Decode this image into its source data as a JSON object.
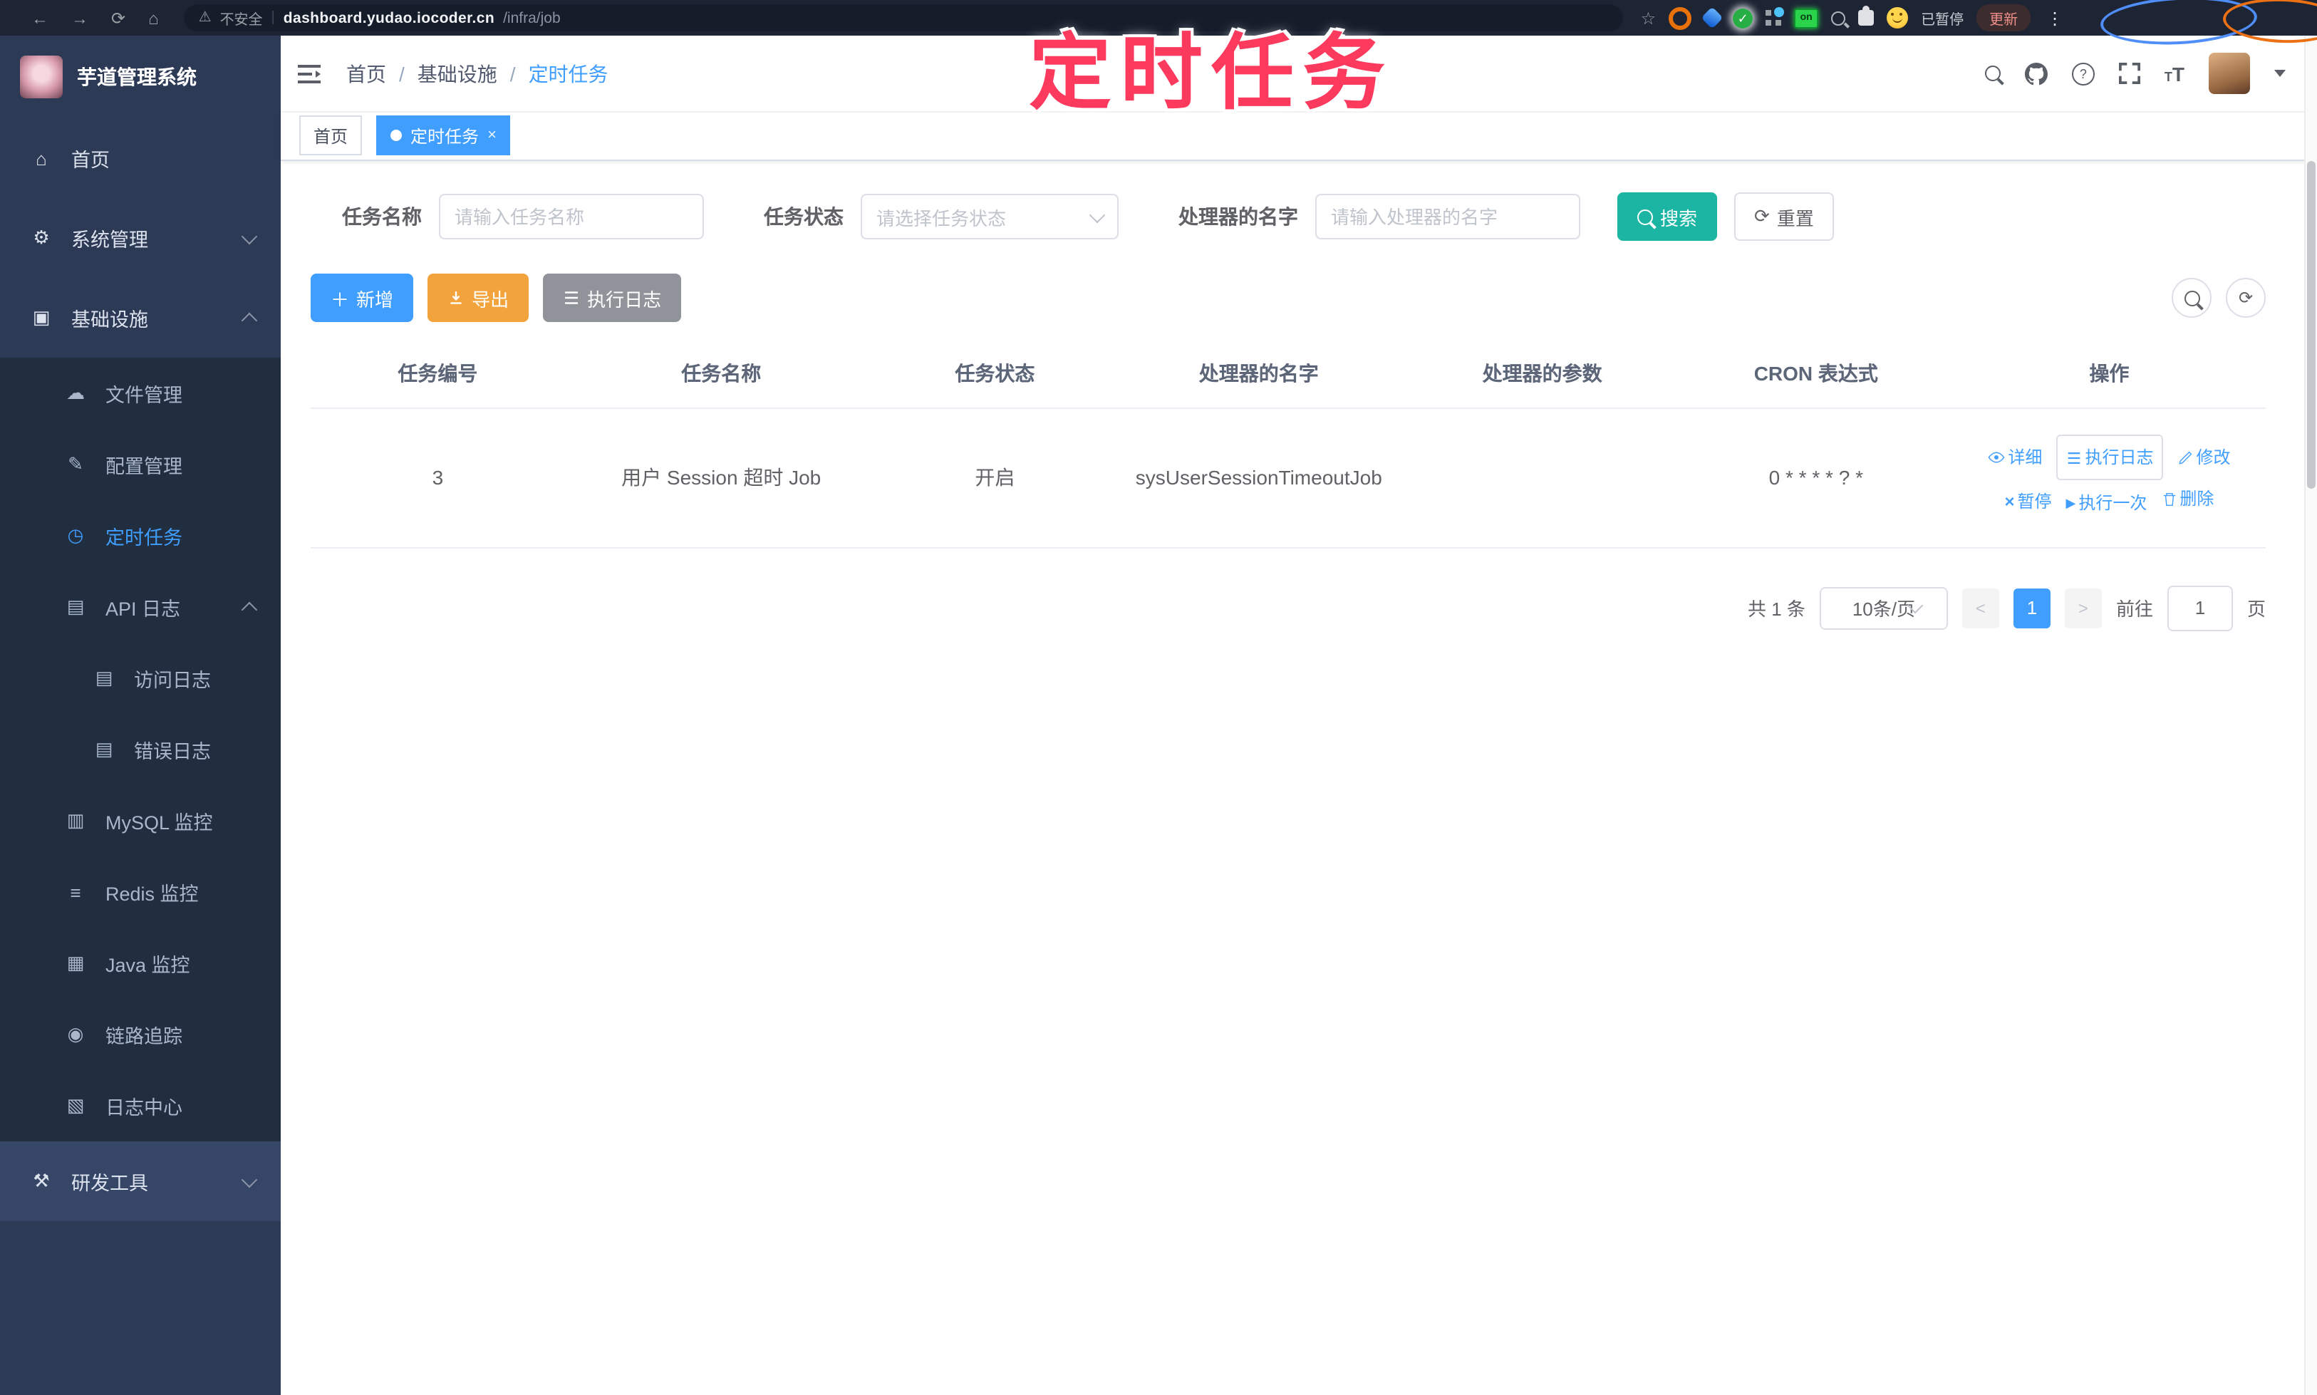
{
  "colors": {
    "primary": "#409eff",
    "search_button": "#1cb5a3",
    "export_button": "#f2a33c",
    "info_button": "#909399",
    "annotation_pink": "#fb3a5e",
    "sidebar_bg": "#2d3a55",
    "submenu_bg": "#202e40"
  },
  "annotation": {
    "text": "定时任务"
  },
  "browser": {
    "security": "不安全",
    "url_domain": "dashboard.yudao.iocoder.cn",
    "url_path": "/infra/job",
    "ext_on_badge": "on",
    "profile_status": "已暂停",
    "update_button": "更新"
  },
  "sidebar": {
    "title": "芋道管理系统",
    "items": [
      {
        "label": "首页",
        "icon": "⌂"
      },
      {
        "label": "系统管理",
        "icon": "⚙"
      },
      {
        "label": "基础设施",
        "icon": "▣"
      },
      {
        "label": "文件管理",
        "icon": "☁"
      },
      {
        "label": "配置管理",
        "icon": "✎"
      },
      {
        "label": "定时任务",
        "icon": "◷"
      },
      {
        "label": "API 日志",
        "icon": "▤"
      },
      {
        "label": "访问日志",
        "icon": "▤"
      },
      {
        "label": "错误日志",
        "icon": "▤"
      },
      {
        "label": "MySQL 监控",
        "icon": "▥"
      },
      {
        "label": "Redis 监控",
        "icon": "≡"
      },
      {
        "label": "Java 监控",
        "icon": "▦"
      },
      {
        "label": "链路追踪",
        "icon": "◉"
      },
      {
        "label": "日志中心",
        "icon": "▧"
      },
      {
        "label": "研发工具",
        "icon": "⚒"
      }
    ]
  },
  "navbar": {
    "breadcrumb": {
      "home": "首页",
      "section": "基础设施",
      "current": "定时任务"
    }
  },
  "tags": {
    "home": "首页",
    "active": "定时任务"
  },
  "filter": {
    "name_label": "任务名称",
    "name_placeholder": "请输入任务名称",
    "status_label": "任务状态",
    "status_placeholder": "请选择任务状态",
    "handler_label": "处理器的名字",
    "handler_placeholder": "请输入处理器的名字",
    "search": "搜索",
    "reset": "重置"
  },
  "toolbar": {
    "add": "新增",
    "export": "导出",
    "exec_log": "执行日志"
  },
  "table": {
    "columns": [
      "任务编号",
      "任务名称",
      "任务状态",
      "处理器的名字",
      "处理器的参数",
      "CRON 表达式",
      "操作"
    ],
    "row": {
      "id": "3",
      "name": "用户 Session 超时 Job",
      "status": "开启",
      "handler": "sysUserSessionTimeoutJob",
      "param": "",
      "cron": "0 * * * * ? *",
      "actions": {
        "detail": "详细",
        "log": "执行日志",
        "edit": "修改",
        "pause": "暂停",
        "run_once": "执行一次",
        "delete": "删除"
      }
    }
  },
  "pagination": {
    "total": "共 1 条",
    "size": "10条/页",
    "page": "1",
    "goto": "前往",
    "unit": "页",
    "goto_value": "1"
  }
}
